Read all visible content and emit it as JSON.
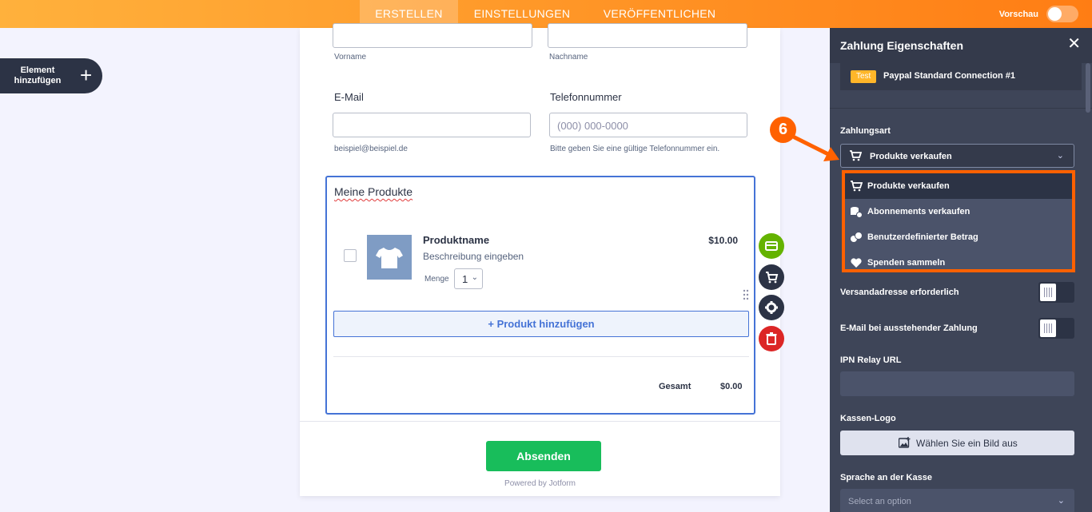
{
  "topbar": {
    "tabs": [
      "ERSTELLEN",
      "EINSTELLUNGEN",
      "VERÖFFENTLICHEN"
    ],
    "active_tab": "ERSTELLEN",
    "preview_label": "Vorschau"
  },
  "add_element": {
    "label": "Element hinzufügen"
  },
  "form": {
    "name_sub": {
      "first": "Vorname",
      "last": "Nachname"
    },
    "email": {
      "label": "E-Mail",
      "sublabel": "beispiel@beispiel.de"
    },
    "phone": {
      "label": "Telefonnummer",
      "placeholder": "(000) 000-0000",
      "sublabel": "Bitte geben Sie eine gültige Telefonnummer ein."
    },
    "products": {
      "title": "Meine Produkte",
      "item": {
        "name": "Produktname",
        "description": "Beschreibung eingeben",
        "quantity_label": "Menge",
        "quantity": "1",
        "price": "$10.00"
      },
      "add_label": "+ Produkt hinzufügen",
      "total_label": "Gesamt",
      "total_value": "$0.00"
    },
    "submit_label": "Absenden",
    "powered_by": "Powered by Jotform"
  },
  "panel": {
    "title": "Zahlung Eigenschaften",
    "connection": {
      "badge": "Test",
      "name": "Paypal Standard Connection #1"
    },
    "payment_type": {
      "label": "Zahlungsart",
      "selected": "Produkte verkaufen",
      "options": [
        "Produkte verkaufen",
        "Abonnements verkaufen",
        "Benutzerdefinierter Betrag",
        "Spenden sammeln"
      ]
    },
    "shipping_label": "Versandadresse erforderlich",
    "pending_email_label": "E-Mail bei ausstehender Zahlung",
    "ipn_label": "IPN Relay URL",
    "logo": {
      "label": "Kassen-Logo",
      "button": "Wählen Sie ein Bild aus"
    },
    "language": {
      "label": "Sprache an der Kasse",
      "placeholder": "Select an option"
    }
  },
  "callout": {
    "number": "6"
  },
  "colors": {
    "accent": "#ff6100",
    "primary_blue": "#4573d6",
    "submit_green": "#18bd5b",
    "panel_bg": "#3e4558"
  }
}
